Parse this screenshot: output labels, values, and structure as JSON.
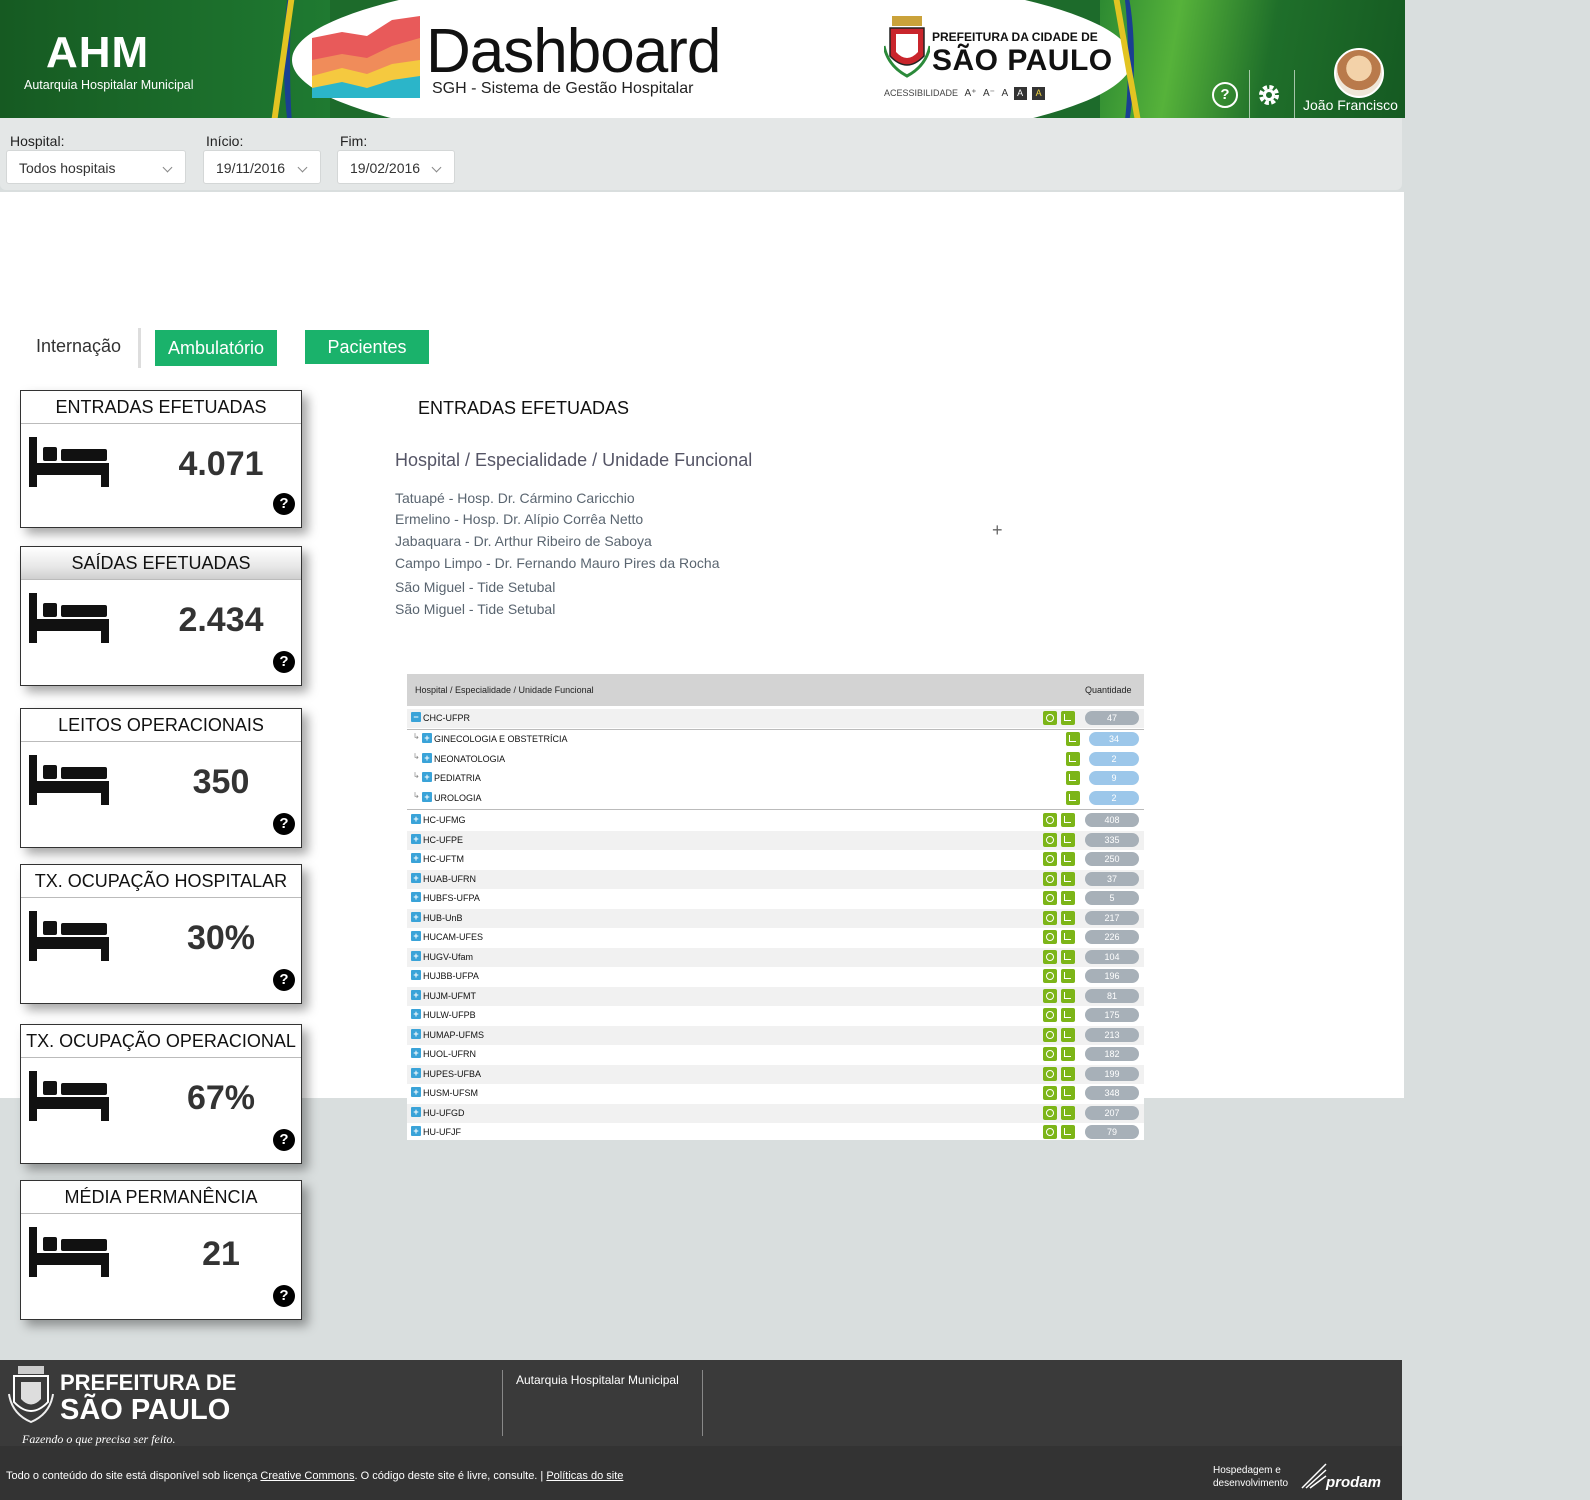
{
  "header": {
    "ahm_logo": "AHM",
    "ahm_subtitle": "Autarquia Hospitalar Municipal",
    "title": "Dashboard",
    "subtitle": "SGH - Sistema de Gestão Hospitalar",
    "pref_small": "PREFEITURA DA CIDADE DE",
    "pref_big": "SÃO PAULO",
    "accessibility": "ACESSIBILIDADE",
    "font_options": [
      "A⁺",
      "A⁻",
      "A"
    ],
    "contrast_options": [
      "A",
      "A"
    ],
    "help": "?",
    "username": "João Francisco"
  },
  "filters": {
    "hospital_label": "Hospital:",
    "hospital_value": "Todos hospitais",
    "inicio_label": "Início:",
    "inicio_value": "19/11/2016",
    "fim_label": "Fim:",
    "fim_value": "19/02/2016"
  },
  "tabs": {
    "internacao": "Internação",
    "ambulatorio": "Ambulatório",
    "pacientes": "Pacientes"
  },
  "cards": [
    {
      "title": "ENTRADAS EFETUADAS",
      "value": "4.071"
    },
    {
      "title": "SAÍDAS EFETUADAS",
      "value": "2.434"
    },
    {
      "title": "LEITOS OPERACIONAIS",
      "value": "350"
    },
    {
      "title": "TX. OCUPAÇÃO HOSPITALAR",
      "value": "30%"
    },
    {
      "title": "TX. OCUPAÇÃO OPERACIONAL",
      "value": "67%"
    },
    {
      "title": "MÉDIA PERMANÊNCIA",
      "value": "21"
    }
  ],
  "card_help": "?",
  "detail": {
    "title": "ENTRADAS EFETUADAS",
    "breadcrumb": "Hospital / Especialidade / Unidade Funcional",
    "hospitals": [
      "Tatuapé - Hosp. Dr. Cármino Caricchio",
      "Ermelino - Hosp. Dr. Alípio Corrêa Netto",
      "Jabaquara - Dr. Arthur Ribeiro de Saboya",
      "Campo Limpo - Dr. Fernando Mauro Pires da Rocha",
      "São Miguel - Tide Setubal",
      "São Miguel - Tide Setubal"
    ],
    "plus": "+"
  },
  "table": {
    "col_name": "Hospital / Especialidade / Unidade Funcional",
    "col_qty": "Quantidade",
    "expanded": {
      "name": "CHC-UFPR",
      "qty": "47",
      "sign": "−"
    },
    "children": [
      {
        "name": "GINECOLOGIA E OBSTETRÍCIA",
        "qty": "34"
      },
      {
        "name": "NEONATOLOGIA",
        "qty": "2"
      },
      {
        "name": "PEDIATRIA",
        "qty": "9"
      },
      {
        "name": "UROLOGIA",
        "qty": "2"
      }
    ],
    "rows": [
      {
        "name": "HC-UFMG",
        "qty": "408"
      },
      {
        "name": "HC-UFPE",
        "qty": "335"
      },
      {
        "name": "HC-UFTM",
        "qty": "250"
      },
      {
        "name": "HUAB-UFRN",
        "qty": "37"
      },
      {
        "name": "HUBFS-UFPA",
        "qty": "5"
      },
      {
        "name": "HUB-UnB",
        "qty": "217"
      },
      {
        "name": "HUCAM-UFES",
        "qty": "226"
      },
      {
        "name": "HUGV-Ufam",
        "qty": "104"
      },
      {
        "name": "HUJBB-UFPA",
        "qty": "196"
      },
      {
        "name": "HUJM-UFMT",
        "qty": "81"
      },
      {
        "name": "HULW-UFPB",
        "qty": "175"
      },
      {
        "name": "HUMAP-UFMS",
        "qty": "213"
      },
      {
        "name": "HUOL-UFRN",
        "qty": "182"
      },
      {
        "name": "HUPES-UFBA",
        "qty": "199"
      },
      {
        "name": "HUSM-UFSM",
        "qty": "348"
      },
      {
        "name": "HU-UFGD",
        "qty": "207"
      },
      {
        "name": "HU-UFJF",
        "qty": "79"
      }
    ],
    "collapsed_sign": "+",
    "child_arrow": "↳"
  },
  "footer": {
    "pref_line1": "PREFEITURA DE",
    "pref_line2": "SÃO PAULO",
    "slogan": "Fazendo o que precisa ser feito.",
    "ahm": "Autarquia Hospitalar Municipal",
    "license_pre": "Todo o conteúdo do site está disponível sob licença ",
    "license_link": "Creative Commons",
    "license_mid": ". O código deste site é livre, consulte. | ",
    "policy_link": "Políticas do site",
    "hosting_line1": "Hospedagem e",
    "hosting_line2": "desenvolvimento",
    "prodam": "prodam"
  },
  "colors": {
    "header_green": "#1d6b2b",
    "tab_green": "#1ab26b",
    "icon_green": "#7cb518",
    "plus_blue": "#3aa3d8"
  }
}
